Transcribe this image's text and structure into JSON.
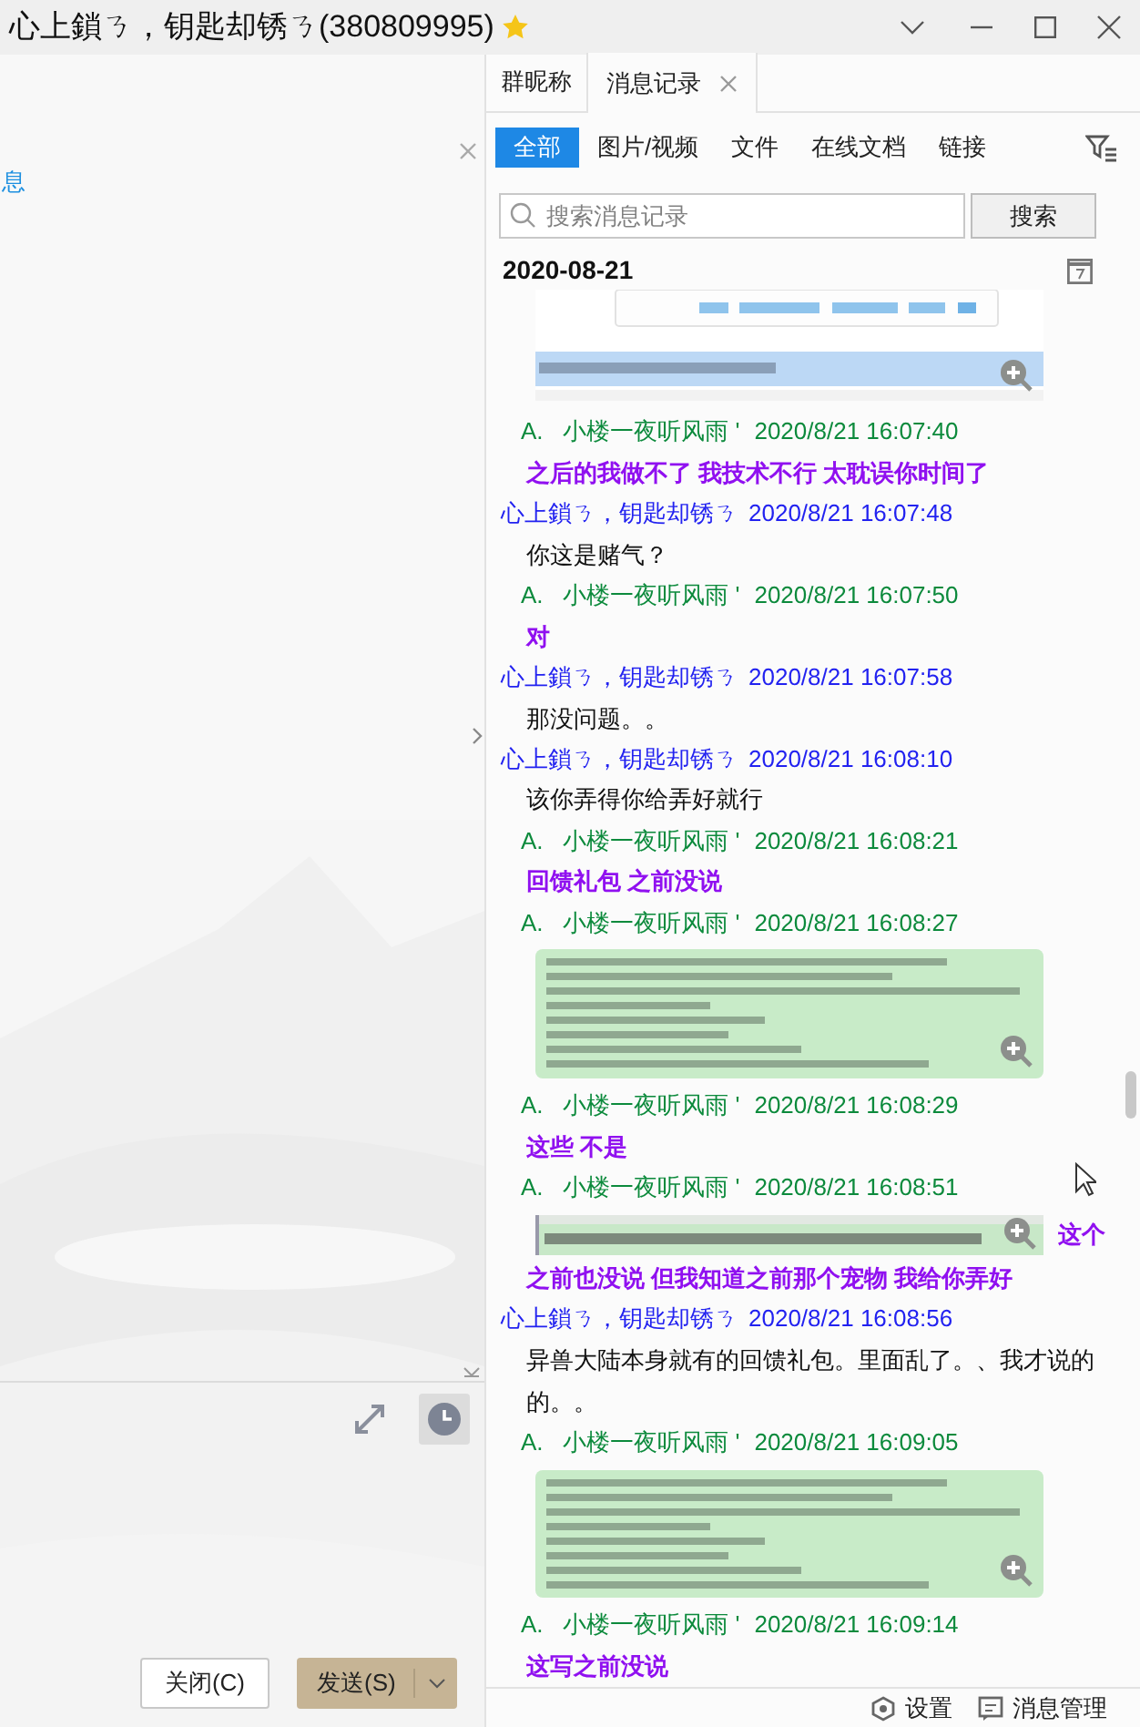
{
  "window": {
    "title": "心上鎖ㄋ，钥匙却锈ㄋ(380809995)",
    "starred": true
  },
  "left_panel": {
    "cut_label": "息"
  },
  "input_buttons": [
    {
      "label": "关闭(C)",
      "kind": "plain"
    },
    {
      "label": "发送(S)",
      "kind": "primary"
    }
  ],
  "tabs": [
    {
      "label": "群昵称",
      "selected": false,
      "closable": false
    },
    {
      "label": "消息记录",
      "selected": true,
      "closable": true
    }
  ],
  "filters": [
    {
      "label": "全部",
      "selected": true
    },
    {
      "label": "图片/视频",
      "selected": false
    },
    {
      "label": "文件",
      "selected": false
    },
    {
      "label": "在线文档",
      "selected": false
    },
    {
      "label": "链接",
      "selected": false
    }
  ],
  "search": {
    "placeholder": "搜索消息记录",
    "button": "搜索"
  },
  "date": "2020-08-21",
  "messages": [
    {
      "parts": [
        {
          "kind": "file_preview"
        }
      ]
    },
    {
      "kind": "incoming",
      "sender": "A.   小楼一夜听风雨 '",
      "time": "2020/8/21 16:07:40",
      "parts": [
        {
          "kind": "text",
          "text": "之后的我做不了  我技术不行  太耽误你时间了"
        }
      ]
    },
    {
      "kind": "outgoing",
      "sender": "心上鎖ㄋ，钥匙却锈ㄋ",
      "time": "2020/8/21 16:07:48",
      "parts": [
        {
          "kind": "text",
          "text": "你这是赌气？"
        }
      ]
    },
    {
      "kind": "incoming",
      "sender": "A.   小楼一夜听风雨 '",
      "time": "2020/8/21 16:07:50",
      "parts": [
        {
          "kind": "text",
          "text": "对"
        }
      ]
    },
    {
      "kind": "outgoing",
      "sender": "心上鎖ㄋ，钥匙却锈ㄋ",
      "time": "2020/8/21 16:07:58",
      "parts": [
        {
          "kind": "text",
          "text": "那没问题。。"
        }
      ]
    },
    {
      "kind": "outgoing",
      "sender": "心上鎖ㄋ，钥匙却锈ㄋ",
      "time": "2020/8/21 16:08:10",
      "parts": [
        {
          "kind": "text",
          "text": "该你弄得你给弄好就行"
        }
      ]
    },
    {
      "kind": "incoming",
      "sender": "A.   小楼一夜听风雨 '",
      "time": "2020/8/21 16:08:21",
      "parts": [
        {
          "kind": "text",
          "text": "回馈礼包 之前没说"
        }
      ]
    },
    {
      "kind": "incoming",
      "sender": "A.   小楼一夜听风雨 '",
      "time": "2020/8/21 16:08:27"
    },
    {
      "kind": "incoming",
      "sender": "A.   小楼一夜听风雨 '",
      "time": "2020/8/21 16:08:29",
      "parts": [
        {
          "kind": "text",
          "text": "这些 不是"
        }
      ]
    },
    {
      "kind": "incoming",
      "sender": "A.   小楼一夜听风雨 '",
      "time": "2020/8/21 16:08:51",
      "parts": [
        {
          "kind": "image_strip"
        },
        {
          "kind": "text",
          "text": "这个"
        },
        {
          "kind": "text",
          "text": "之前也没说  但我知道之前那个宠物 我给你弄好"
        }
      ]
    },
    {
      "kind": "outgoing",
      "sender": "心上鎖ㄋ，钥匙却锈ㄋ",
      "time": "2020/8/21 16:08:56",
      "parts": [
        {
          "kind": "text",
          "text": "异兽大陆本身就有的回馈礼包。里面乱了。、我才说的的。。"
        }
      ]
    },
    {
      "kind": "incoming",
      "sender": "A.   小楼一夜听风雨 '",
      "time": "2020/8/21 16:09:05"
    },
    {
      "kind": "incoming",
      "sender": "A.   小楼一夜听风雨 '",
      "time": "2020/8/21 16:09:14",
      "parts": [
        {
          "kind": "text",
          "text": "这写之前没说"
        }
      ]
    }
  ],
  "footer": [
    {
      "kind": "settings",
      "label": "设置"
    },
    {
      "kind": "manage",
      "label": "消息管理"
    }
  ]
}
